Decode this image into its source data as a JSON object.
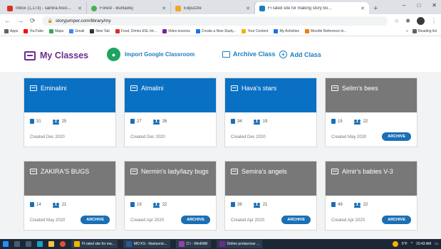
{
  "browser": {
    "tabs": [
      {
        "label": "Inbox (1,173) - samira.fosic@iusc...",
        "color": "#d93025"
      },
      {
        "label": "Forest - Buntavkij",
        "color": "#4caf50"
      },
      {
        "label": "Edpuzzle",
        "color": "#f5a623"
      },
      {
        "label": "Fl rated site for making story bo...",
        "color": "#1a7ec0",
        "active": true
      }
    ],
    "new_tab": "+",
    "window_controls": [
      "–",
      "□",
      "✕"
    ],
    "url": "storyjumper.com/library/my",
    "bookmarks": [
      {
        "label": "Apps",
        "color": "#5f6368"
      },
      {
        "label": "YouTube",
        "color": "#ff0000"
      },
      {
        "label": "Maps",
        "color": "#34a853"
      },
      {
        "label": "Gmail",
        "color": "#4285f4"
      },
      {
        "label": "New Tab",
        "color": "#333333"
      },
      {
        "label": "Food, Drinks ESL Int...",
        "color": "#d93025"
      },
      {
        "label": "Video lessons",
        "color": "#7b1fa2"
      },
      {
        "label": "Create a New Study...",
        "color": "#1a73e8"
      },
      {
        "label": "Your Content",
        "color": "#f4b400"
      },
      {
        "label": "My Activities",
        "color": "#1a73e8"
      },
      {
        "label": "Moodle Reference to...",
        "color": "#f57c00"
      }
    ],
    "reading_list": "Reading list"
  },
  "header": {
    "title": "My Classes",
    "import": "Import Google Classroom",
    "archive": "Archive Class",
    "add": "Add Class"
  },
  "classes": [
    {
      "name": "Eminalini",
      "books": "31",
      "students": "25",
      "created": "Created Dec 2020",
      "color": "blue"
    },
    {
      "name": "Almalini",
      "books": "27",
      "students": "26",
      "created": "Created Dec 2020",
      "color": "blue"
    },
    {
      "name": "Hava's stars",
      "books": "34",
      "students": "19",
      "created": "Created Dec 2020",
      "color": "blue"
    },
    {
      "name": "Selim's bees",
      "books": "15",
      "students": "22",
      "created": "Created May 2020",
      "color": "gray",
      "archive": "ARCHIVE"
    },
    {
      "name": "ZAKIRA'S BUGS",
      "books": "14",
      "students": "21",
      "created": "Created May 2020",
      "color": "gray",
      "archive": "ARCHIVE"
    },
    {
      "name": "Nermin's lady/lazy bugs",
      "books": "19",
      "students": "22",
      "created": "Created Apr 2020",
      "color": "gray",
      "archive": "ARCHIVE"
    },
    {
      "name": "Semira's angels",
      "books": "36",
      "students": "21",
      "created": "Created Apr 2020",
      "color": "gray",
      "archive": "ARCHIVE"
    },
    {
      "name": "Almir's babies V-3",
      "books": "49",
      "students": "22",
      "created": "Created Apr 2020",
      "color": "gray",
      "archive": "ARCHIVE"
    }
  ],
  "taskbar": {
    "apps": [
      {
        "label": "Fl rated site for ma...",
        "color": "#f4b400"
      },
      {
        "label": "MO KS - Nastavnic...",
        "color": "#2b579a"
      },
      {
        "label": "C:\\ - WinRAR",
        "color": "#8e44ad"
      },
      {
        "label": "Online prelascivar ...",
        "color": "#6a2c8c"
      }
    ],
    "weather": "5°F",
    "time": "10:43 AM"
  }
}
